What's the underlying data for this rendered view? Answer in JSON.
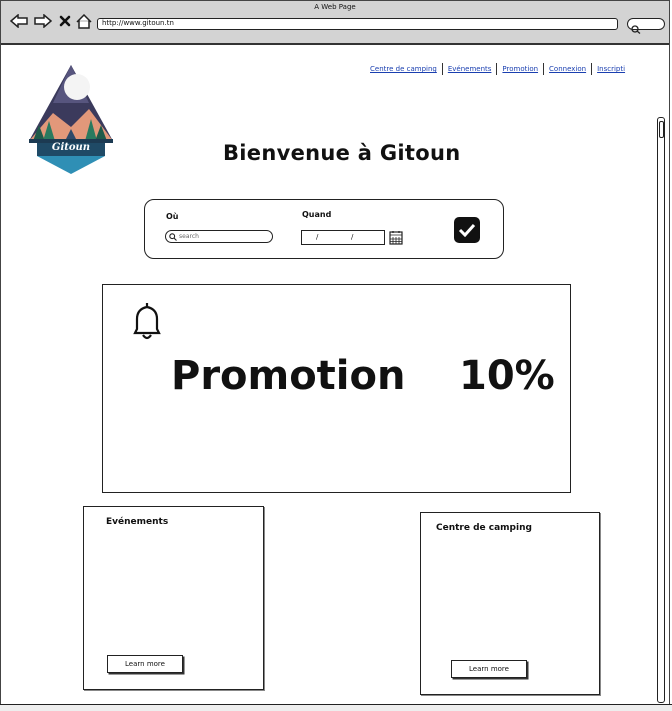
{
  "window": {
    "title": "A Web Page",
    "url": "http://www.gitoun.tn"
  },
  "nav": {
    "items": [
      "Centre de camping",
      "Evénements",
      "Promotion",
      "Connexion",
      "Inscripti"
    ]
  },
  "logo": {
    "text": "Gitoun"
  },
  "welcome": "Bienvenue à Gitoun",
  "search": {
    "where_label": "Où",
    "placeholder": "search",
    "when_label": "Quand",
    "date_sep1": "/",
    "date_sep2": "/"
  },
  "promo": {
    "title": "Promotion",
    "value": "10%"
  },
  "cards": [
    {
      "title": "Evénements",
      "button": "Learn more"
    },
    {
      "title": "Centre de camping",
      "button": "Learn more"
    }
  ],
  "icons": {
    "back": "arrow-left-icon",
    "forward": "arrow-right-icon",
    "stop": "close-icon",
    "home": "home-icon",
    "calendar": "calendar-icon",
    "bell": "bell-icon",
    "check": "checkbox-checked-icon"
  }
}
